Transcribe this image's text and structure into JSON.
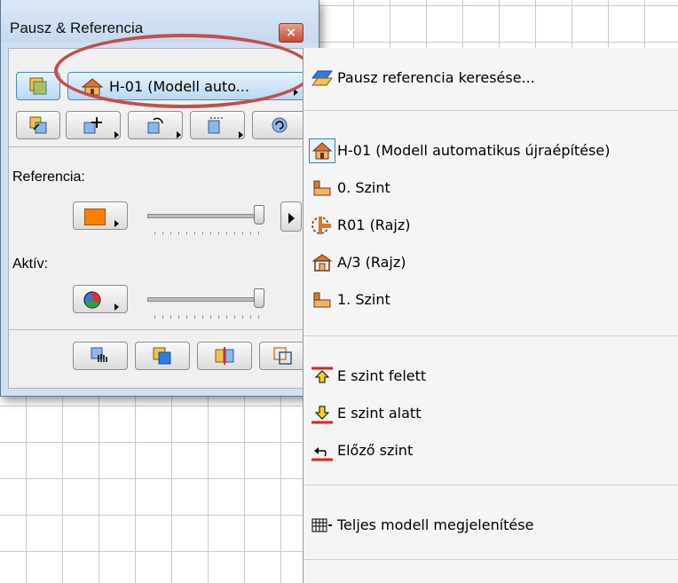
{
  "palette": {
    "title": "Pausz & Referencia",
    "close_glyph": "×",
    "reference_button_label": "H-01 (Modell auto...",
    "referencia_label": "Referencia:",
    "aktiv_label": "Aktív:",
    "colors": {
      "reference_color": "#ff8000",
      "highlight_ring": "#c0504d",
      "selection_blue": "#3c7fb1"
    }
  },
  "menu": {
    "search_item": "Pausz referencia keresése...",
    "items": [
      {
        "label": "H-01 (Modell automatikus újraépítése)",
        "icon": "house-icon",
        "checked": true
      },
      {
        "label": "0. Szint",
        "icon": "story-icon",
        "checked": false
      },
      {
        "label": "R01 (Rajz)",
        "icon": "section-marker-icon",
        "checked": false
      },
      {
        "label": "A/3 (Rajz)",
        "icon": "elevation-icon",
        "checked": false
      },
      {
        "label": "1. Szint",
        "icon": "story-icon",
        "checked": false
      }
    ],
    "level_items": [
      {
        "label": "E szint felett",
        "icon": "arrow-up-icon"
      },
      {
        "label": "E szint alatt",
        "icon": "arrow-down-icon"
      },
      {
        "label": "Előző szint",
        "icon": "undo-arrow-icon"
      }
    ],
    "model_item": "Teljes modell megjelenítése"
  }
}
